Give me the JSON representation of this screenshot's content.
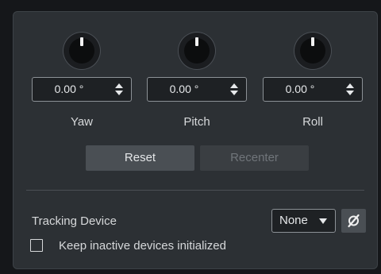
{
  "rotation": [
    {
      "label": "Yaw",
      "value": "0.00 °",
      "knob_position": 0.5
    },
    {
      "label": "Pitch",
      "value": "0.00 °",
      "knob_position": 0.5
    },
    {
      "label": "Roll",
      "value": "0.00 °",
      "knob_position": 0.5
    }
  ],
  "buttons": {
    "reset": "Reset",
    "recenter": "Recenter"
  },
  "tracking": {
    "label": "Tracking Device",
    "selected": "None",
    "sync_icon": "sync-off-icon"
  },
  "keep_inactive": {
    "label": "Keep inactive devices initialized",
    "checked": false
  }
}
